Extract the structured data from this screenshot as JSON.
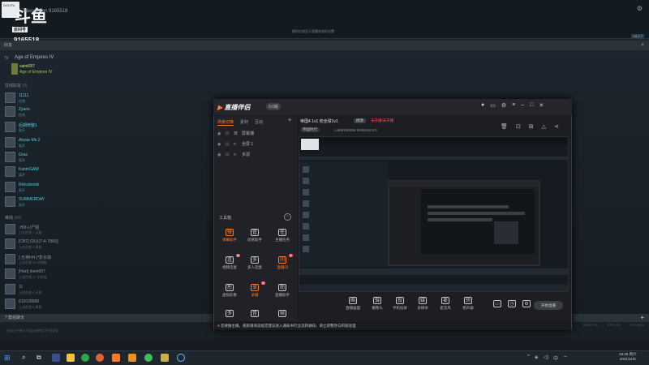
{
  "steam": {
    "room_title": "Davum Ten",
    "room_number": "9165518",
    "room_number_badge": "9165518",
    "brand_hanzi": "斗鱼",
    "brand_tag": "房间号",
    "top_center_text": "随时在线显示直播状态的设置",
    "version_badge": "V8.1.7",
    "friends_header": "好友",
    "now_playing_label": "IV",
    "now_playing_game": "Age of Empires IV",
    "playing_user": "saint087",
    "playing_user_game": "Age of Empires IV",
    "online_label": "在线好友",
    "online_count": "(8)",
    "online_friends": [
      {
        "name": "11111",
        "status": "在线"
      },
      {
        "name": "Zyans",
        "status": "在线"
      },
      {
        "name": "后期修整1",
        "status": "离开"
      },
      {
        "name": "Akstar Mk.2",
        "status": "离开"
      },
      {
        "name": "Gras",
        "status": "离开"
      },
      {
        "name": "KanInGAW",
        "status": "离开"
      },
      {
        "name": "Nickolonski",
        "status": "离开"
      },
      {
        "name": "SUMMERDAY",
        "status": "离开"
      }
    ],
    "offline_label": "离线",
    "offline_count": "(43)",
    "offline_friends": [
      {
        "name": "-H0I-LI尸妮",
        "status": "上次在线 1 天前"
      },
      {
        "name": "[CB7] (DU)(7-4-7(B0)]",
        "status": "上次在线 3 周前"
      },
      {
        "name": "[-无神HH-]*影长踪",
        "status": "上次在线 24 分钟前"
      },
      {
        "name": "[Hart] dsen007",
        "status": "上次在线 17 小时前"
      },
      {
        "name": "11",
        "status": "上次在线 2 天前"
      },
      {
        "name": "815028888",
        "status": "上次在线 5 周前"
      }
    ],
    "group_chats_label": "群组聊天",
    "chat_placeholder": "在聊天中输入内容或拖拽文件到此处",
    "stats": [
      "TEMP 74°C",
      "CPU 9%",
      "RAM 57%",
      "GPU 2%",
      "GPU 45%"
    ]
  },
  "app": {
    "logo_text": "直播伴侣",
    "version": "9.0版",
    "tabs": [
      "场景切换",
      "素材",
      "互动"
    ],
    "scenes": [
      {
        "icon": "日",
        "name": "屏幕捕"
      },
      {
        "icon": "□",
        "name": "全屏 1"
      },
      {
        "icon": "□",
        "name": "多源"
      }
    ],
    "toolbox_label": "工具箱",
    "tools": [
      {
        "label": "弹幕助手",
        "icon": "弹",
        "orange": true
      },
      {
        "label": "房管助手",
        "icon": "管",
        "orange": false
      },
      {
        "label": "主播任务",
        "icon": "任",
        "orange": false
      },
      {
        "label": "视频连麦",
        "icon": "连",
        "orange": false,
        "badge": "新"
      },
      {
        "label": "多人连麦",
        "icon": "多",
        "orange": false
      },
      {
        "label": "直播间",
        "icon": "间",
        "orange": true,
        "badge": "新"
      },
      {
        "label": "虚拟形象",
        "icon": "形",
        "orange": false
      },
      {
        "label": "录播",
        "icon": "录",
        "orange": true,
        "badge": "新"
      },
      {
        "label": "直播助手",
        "icon": "助",
        "orange": false
      },
      {
        "label": "更多",
        "icon": "多",
        "orange": false
      },
      {
        "label": "音效",
        "icon": "音",
        "orange": false
      },
      {
        "label": "帧率",
        "icon": "帧",
        "orange": false
      }
    ],
    "room_header": "帝国4 1v1 欢全球1v1",
    "edit_label": "修改",
    "live_status": "未开播/未开播",
    "category": "帝国时代",
    "userinfo": "Lu6t8106066  9165518  8 0",
    "bottom_tools": [
      {
        "label": "直播画面",
        "icon": "画"
      },
      {
        "label": "摄像头",
        "icon": "摄"
      },
      {
        "label": "手机投屏",
        "icon": "投"
      },
      {
        "label": "多媒体",
        "icon": "媒"
      },
      {
        "label": "麦克风",
        "icon": "麦"
      },
      {
        "label": "扬声器",
        "icon": "扬"
      }
    ],
    "start_label": "开始直播",
    "notice": "您要做主播，规则请阅读规定建议进入通知书行业流转通知，请立即整改与积极处理"
  },
  "taskbar": {
    "time": "18:45 周六",
    "date": "2021/11/6"
  },
  "colors": {
    "accent_orange": "#ff7a30",
    "steam_online": "#57cbde",
    "steam_ingame": "#9ec24a"
  }
}
